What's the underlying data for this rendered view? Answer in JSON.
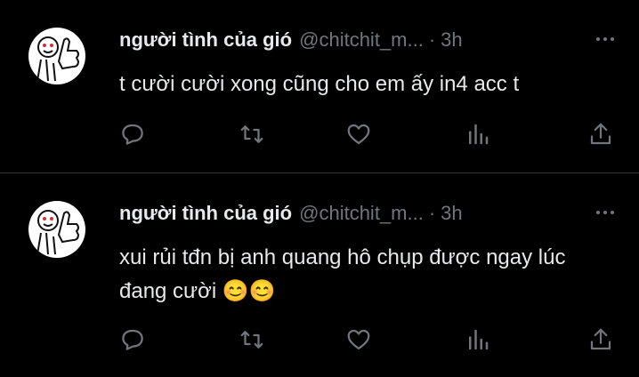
{
  "tweets": [
    {
      "name": "người tình của gió",
      "handle": "@chitchit_m...",
      "separator": "·",
      "time": "3h",
      "text": "t cười cười xong cũng cho em ấy in4 acc t"
    },
    {
      "name": "người tình của gió",
      "handle": "@chitchit_m...",
      "separator": "·",
      "time": "3h",
      "text": "xui rủi tđn bị anh quang hô chụp được ngay lúc đang cười 😊😊"
    }
  ],
  "icons": {
    "reply": "reply-icon",
    "retweet": "retweet-icon",
    "like": "heart-icon",
    "views": "views-icon",
    "share": "share-icon",
    "more": "more-icon"
  },
  "colors": {
    "background": "#000000",
    "text": "#e7e9ea",
    "muted": "#71767b",
    "divider": "#2f3336"
  }
}
